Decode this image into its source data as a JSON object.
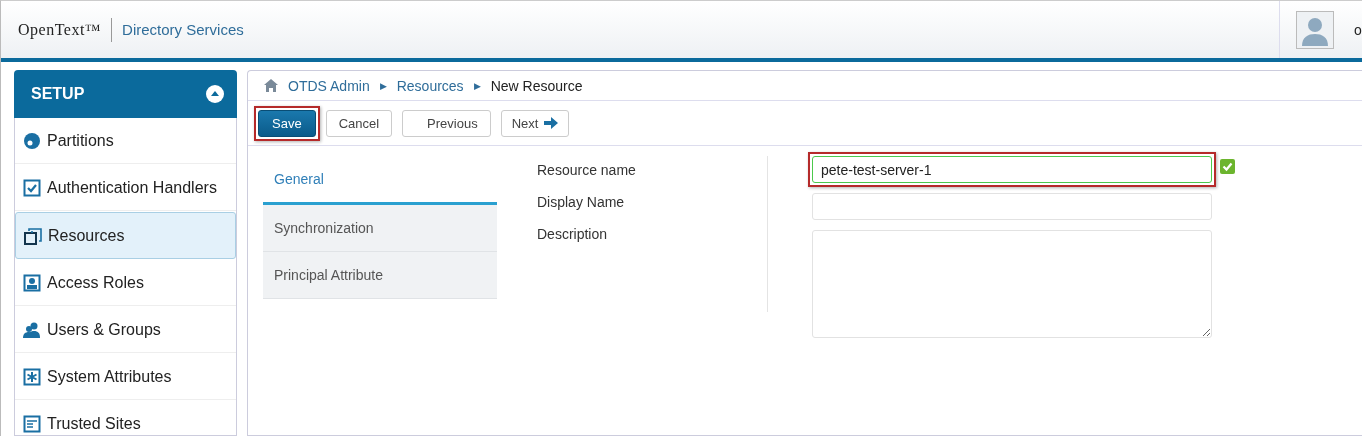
{
  "header": {
    "brand": "OpenText™",
    "product": "Directory Services",
    "user_initial": "o"
  },
  "sidebar": {
    "title": "SETUP",
    "items": [
      {
        "label": "Partitions",
        "selected": false
      },
      {
        "label": "Authentication Handlers",
        "selected": false
      },
      {
        "label": "Resources",
        "selected": true
      },
      {
        "label": "Access Roles",
        "selected": false
      },
      {
        "label": "Users & Groups",
        "selected": false
      },
      {
        "label": "System Attributes",
        "selected": false
      },
      {
        "label": "Trusted Sites",
        "selected": false
      }
    ]
  },
  "breadcrumb": [
    {
      "label": "OTDS Admin",
      "kind": "link"
    },
    {
      "separator": "▶",
      "label": "Resources",
      "kind": "link"
    },
    {
      "separator": "▶",
      "label": "New Resource",
      "kind": "current"
    }
  ],
  "toolbar": [
    {
      "label": "Save",
      "kind": "primary",
      "highlighted": true
    },
    {
      "label": "Cancel",
      "kind": "plain",
      "highlighted": false
    },
    {
      "label": "Previous",
      "kind": "plain",
      "highlighted": false
    },
    {
      "label": "Next",
      "kind": "next",
      "highlighted": false
    }
  ],
  "tabs": [
    {
      "label": "General",
      "selected": true
    },
    {
      "label": "Synchronization",
      "selected": false
    },
    {
      "label": "Principal Attribute",
      "selected": false
    }
  ],
  "fields": [
    {
      "label": "Resource name",
      "kind": "input",
      "value": "pete-test-server-1",
      "valid": true,
      "highlighted": true
    },
    {
      "label": "Display Name",
      "kind": "input",
      "valid": false,
      "highlighted": false
    },
    {
      "label": "Description",
      "kind": "textarea",
      "valid": false,
      "highlighted": false
    }
  ]
}
